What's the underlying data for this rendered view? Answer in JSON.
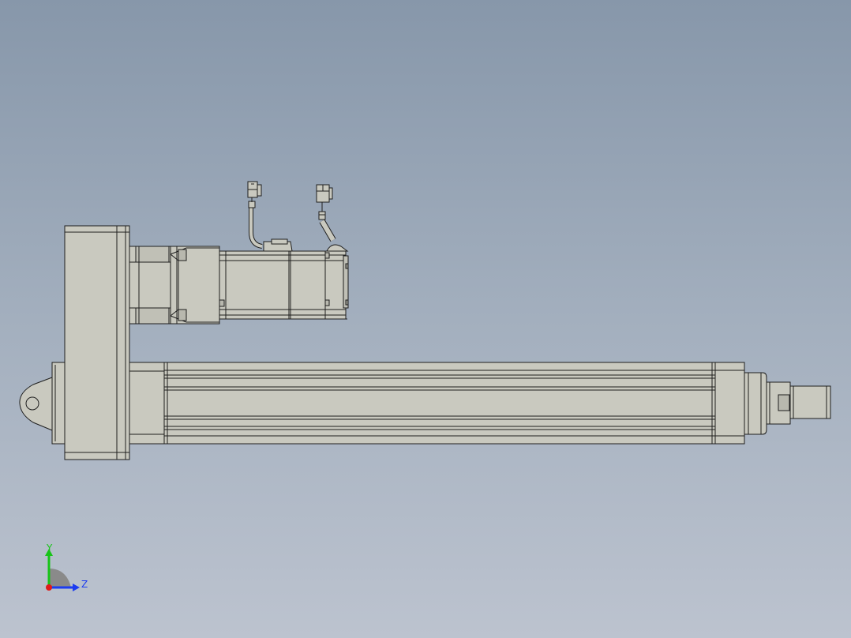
{
  "viewport": {
    "background_top": "#8797aa",
    "background_bottom": "#bcc3cf",
    "part_fill": "#c9c9bf",
    "part_shadow": "#b8b8ae",
    "edge_color": "#1e1e1e"
  },
  "triad": {
    "y_label": "Y",
    "z_label": "Z",
    "y_color": "#17c417",
    "z_color": "#1c3cf0",
    "x_color": "#e01a1a"
  }
}
